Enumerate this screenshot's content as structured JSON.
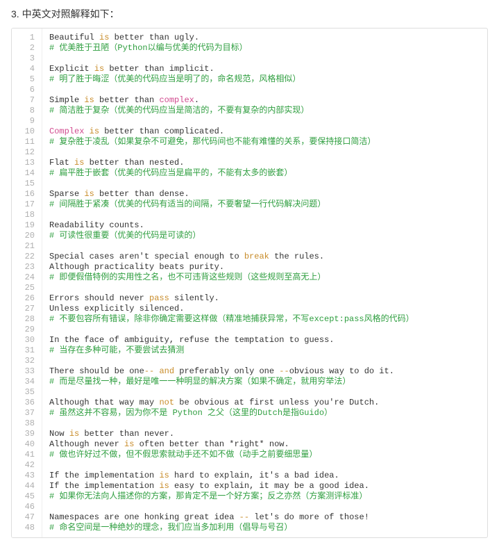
{
  "heading": "3. 中英文对照解释如下：",
  "code": {
    "total_lines": 48,
    "lines": [
      {
        "n": 1,
        "tokens": [
          {
            "t": "Beautiful "
          },
          {
            "t": "is",
            "c": "kw"
          },
          {
            "t": " better than ugly."
          }
        ]
      },
      {
        "n": 2,
        "tokens": [
          {
            "t": "# 优美胜于丑陋（Python以编与优美的代码为目标）",
            "c": "cm"
          }
        ]
      },
      {
        "n": 3,
        "tokens": []
      },
      {
        "n": 4,
        "tokens": [
          {
            "t": "Explicit "
          },
          {
            "t": "is",
            "c": "kw"
          },
          {
            "t": " better than implicit."
          }
        ]
      },
      {
        "n": 5,
        "tokens": [
          {
            "t": "# 明了胜于晦涩（优美的代码应当是明了的，命名规范，风格相似）",
            "c": "cm"
          }
        ]
      },
      {
        "n": 6,
        "tokens": []
      },
      {
        "n": 7,
        "tokens": [
          {
            "t": "Simple "
          },
          {
            "t": "is",
            "c": "kw"
          },
          {
            "t": " better than "
          },
          {
            "t": "complex",
            "c": "name"
          },
          {
            "t": "."
          }
        ]
      },
      {
        "n": 8,
        "tokens": [
          {
            "t": "# 简洁胜于复杂（优美的代码应当是简洁的，不要有复杂的内部实现）",
            "c": "cm"
          }
        ]
      },
      {
        "n": 9,
        "tokens": []
      },
      {
        "n": 10,
        "tokens": [
          {
            "t": "Complex",
            "c": "name"
          },
          {
            "t": " "
          },
          {
            "t": "is",
            "c": "kw"
          },
          {
            "t": " better than complicated."
          }
        ]
      },
      {
        "n": 11,
        "tokens": [
          {
            "t": "# 复杂胜于凌乱（如果复杂不可避免，那代码间也不能有难懂的关系，要保持接口简洁）",
            "c": "cm"
          }
        ]
      },
      {
        "n": 12,
        "tokens": []
      },
      {
        "n": 13,
        "tokens": [
          {
            "t": "Flat "
          },
          {
            "t": "is",
            "c": "kw"
          },
          {
            "t": " better than nested."
          }
        ]
      },
      {
        "n": 14,
        "tokens": [
          {
            "t": "# 扁平胜于嵌套（优美的代码应当是扁平的，不能有太多的嵌套）",
            "c": "cm"
          }
        ]
      },
      {
        "n": 15,
        "tokens": []
      },
      {
        "n": 16,
        "tokens": [
          {
            "t": "Sparse "
          },
          {
            "t": "is",
            "c": "kw"
          },
          {
            "t": " better than dense."
          }
        ]
      },
      {
        "n": 17,
        "tokens": [
          {
            "t": "# 间隔胜于紧凑（优美的代码有适当的间隔，不要奢望一行代码解决问题）",
            "c": "cm"
          }
        ]
      },
      {
        "n": 18,
        "tokens": []
      },
      {
        "n": 19,
        "tokens": [
          {
            "t": "Readability counts."
          }
        ]
      },
      {
        "n": 20,
        "tokens": [
          {
            "t": "# 可读性很重要（优美的代码是可读的）",
            "c": "cm"
          }
        ]
      },
      {
        "n": 21,
        "tokens": []
      },
      {
        "n": 22,
        "tokens": [
          {
            "t": "Special cases aren't special enough to "
          },
          {
            "t": "break",
            "c": "kw"
          },
          {
            "t": " the rules."
          }
        ]
      },
      {
        "n": 23,
        "tokens": [
          {
            "t": "Although practicality beats purity."
          }
        ]
      },
      {
        "n": 24,
        "tokens": [
          {
            "t": "# 即便假借特例的实用性之名，也不可违背这些规则（这些规则至高无上）",
            "c": "cm"
          }
        ]
      },
      {
        "n": 25,
        "tokens": []
      },
      {
        "n": 26,
        "tokens": [
          {
            "t": "Errors should never "
          },
          {
            "t": "pass",
            "c": "kw"
          },
          {
            "t": " silently."
          }
        ]
      },
      {
        "n": 27,
        "tokens": [
          {
            "t": "Unless explicitly silenced."
          }
        ]
      },
      {
        "n": 28,
        "tokens": [
          {
            "t": "# 不要包容所有错误，除非你确定需要这样做（精准地捕获异常，不写except:pass风格的代码）",
            "c": "cm"
          }
        ]
      },
      {
        "n": 29,
        "tokens": []
      },
      {
        "n": 30,
        "tokens": [
          {
            "t": "In the face of ambiguity, refuse the temptation to guess."
          }
        ]
      },
      {
        "n": 31,
        "tokens": [
          {
            "t": "# 当存在多种可能，不要尝试去猜测",
            "c": "cm"
          }
        ]
      },
      {
        "n": 32,
        "tokens": []
      },
      {
        "n": 33,
        "tokens": [
          {
            "t": "There should be one"
          },
          {
            "t": "--",
            "c": "op"
          },
          {
            "t": " "
          },
          {
            "t": "and",
            "c": "kw"
          },
          {
            "t": " preferably only one "
          },
          {
            "t": "--",
            "c": "op"
          },
          {
            "t": "obvious way to do it."
          }
        ]
      },
      {
        "n": 34,
        "tokens": [
          {
            "t": "# 而是尽量找一种，最好是唯一一种明显的解决方案（如果不确定，就用穷举法）",
            "c": "cm"
          }
        ]
      },
      {
        "n": 35,
        "tokens": []
      },
      {
        "n": 36,
        "tokens": [
          {
            "t": "Although that way may "
          },
          {
            "t": "not",
            "c": "kw"
          },
          {
            "t": " be obvious at first unless you're Dutch."
          }
        ]
      },
      {
        "n": 37,
        "tokens": [
          {
            "t": "# 虽然这并不容易，因为你不是 Python 之父（这里的Dutch是指Guido）",
            "c": "cm"
          }
        ]
      },
      {
        "n": 38,
        "tokens": []
      },
      {
        "n": 39,
        "tokens": [
          {
            "t": "Now "
          },
          {
            "t": "is",
            "c": "kw"
          },
          {
            "t": " better than never."
          }
        ]
      },
      {
        "n": 40,
        "tokens": [
          {
            "t": "Although never "
          },
          {
            "t": "is",
            "c": "kw"
          },
          {
            "t": " often better than *right* now."
          }
        ]
      },
      {
        "n": 41,
        "tokens": [
          {
            "t": "# 做也许好过不做，但不假思索就动手还不如不做（动手之前要细思量）",
            "c": "cm"
          }
        ]
      },
      {
        "n": 42,
        "tokens": []
      },
      {
        "n": 43,
        "tokens": [
          {
            "t": "If the implementation "
          },
          {
            "t": "is",
            "c": "kw"
          },
          {
            "t": " hard to explain, it's a bad idea."
          }
        ]
      },
      {
        "n": 44,
        "tokens": [
          {
            "t": "If the implementation "
          },
          {
            "t": "is",
            "c": "kw"
          },
          {
            "t": " easy to explain, it may be a good idea."
          }
        ]
      },
      {
        "n": 45,
        "tokens": [
          {
            "t": "# 如果你无法向人描述你的方案，那肯定不是一个好方案；反之亦然（方案测评标准）",
            "c": "cm"
          }
        ]
      },
      {
        "n": 46,
        "tokens": []
      },
      {
        "n": 47,
        "tokens": [
          {
            "t": "Namespaces are one honking great idea "
          },
          {
            "t": "--",
            "c": "op"
          },
          {
            "t": " let's do more of those!"
          }
        ]
      },
      {
        "n": 48,
        "tokens": [
          {
            "t": "# 命名空间是一种绝妙的理念，我们应当多加利用（倡导与号召）",
            "c": "cm"
          }
        ]
      }
    ]
  }
}
